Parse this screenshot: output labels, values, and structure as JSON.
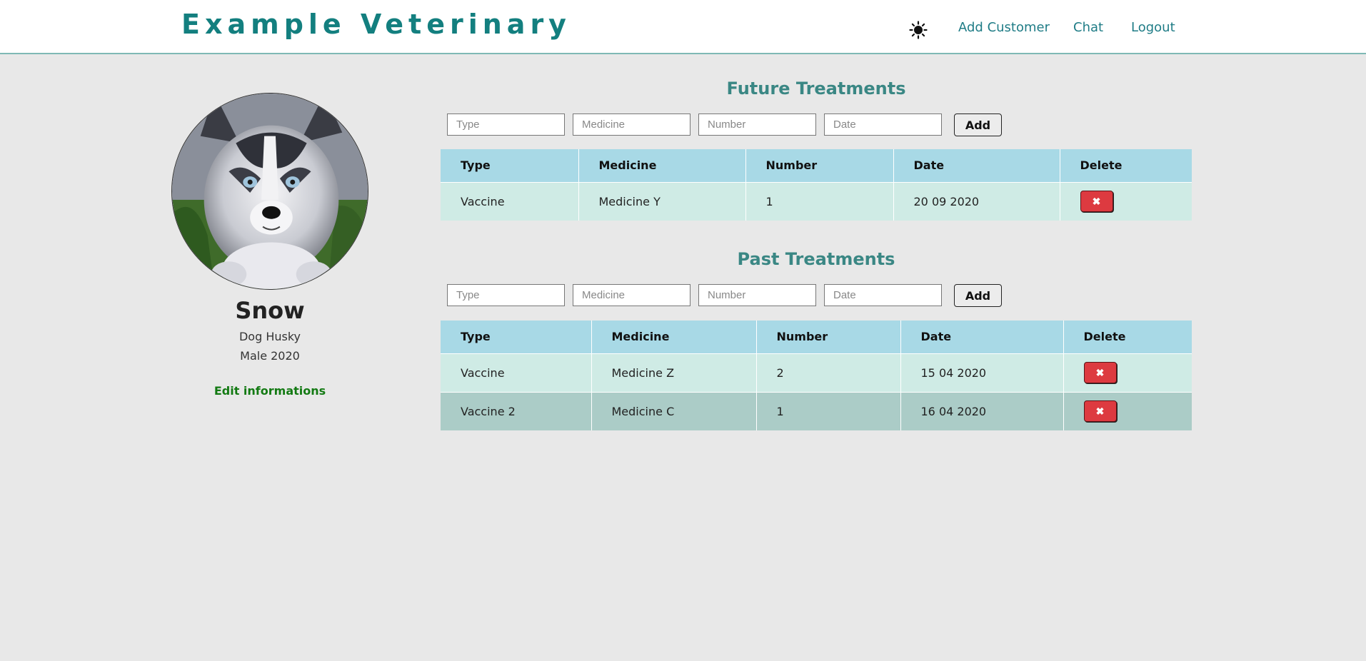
{
  "header": {
    "brand": "Example Veterinary",
    "theme_icon": "sun-icon",
    "nav": [
      {
        "label": "Add Customer"
      },
      {
        "label": "Chat"
      },
      {
        "label": "Logout"
      }
    ]
  },
  "pet": {
    "name": "Snow",
    "species_breed": "Dog Husky",
    "sex_year": "Male 2020",
    "edit_label": "Edit informations"
  },
  "future": {
    "title": "Future Treatments",
    "form": {
      "type_placeholder": "Type",
      "medicine_placeholder": "Medicine",
      "number_placeholder": "Number",
      "date_placeholder": "Date",
      "add_label": "Add"
    },
    "columns": [
      "Type",
      "Medicine",
      "Number",
      "Date",
      "Delete"
    ],
    "rows": [
      {
        "type": "Vaccine",
        "medicine": "Medicine Y",
        "number": "1",
        "date": "20 09 2020",
        "delete": "✖"
      }
    ]
  },
  "past": {
    "title": "Past Treatments",
    "form": {
      "type_placeholder": "Type",
      "medicine_placeholder": "Medicine",
      "number_placeholder": "Number",
      "date_placeholder": "Date",
      "add_label": "Add"
    },
    "columns": [
      "Type",
      "Medicine",
      "Number",
      "Date",
      "Delete"
    ],
    "rows": [
      {
        "type": "Vaccine",
        "medicine": "Medicine Z",
        "number": "2",
        "date": "15 04 2020",
        "delete": "✖"
      },
      {
        "type": "Vaccine 2",
        "medicine": "Medicine C",
        "number": "1",
        "date": "16 04 2020",
        "delete": "✖"
      }
    ]
  },
  "colors": {
    "brand": "#137f7f",
    "nav": "#1f7c86",
    "section_title": "#3a8784",
    "header_row": "#a8d9e6",
    "row_odd": "#cfebe5",
    "row_even": "#abccc7",
    "delete": "#dd3a40",
    "edit_link": "#137a13"
  }
}
